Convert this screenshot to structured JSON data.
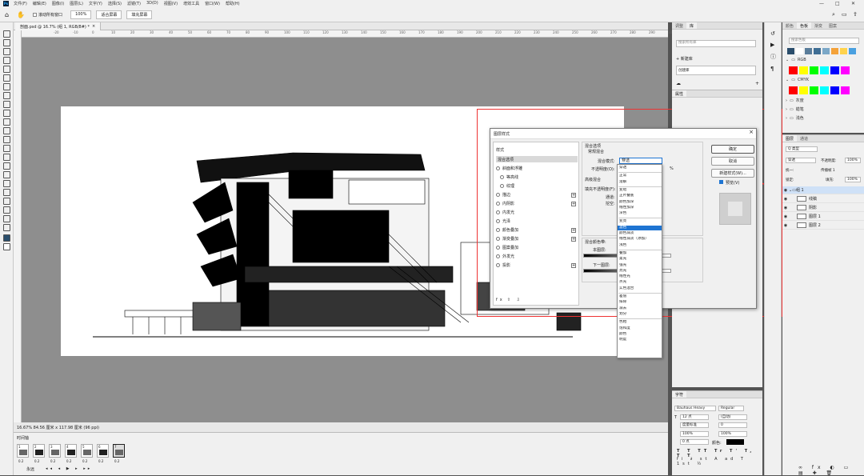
{
  "menu": {
    "logo": "Ps",
    "items": [
      "文件(F)",
      "编辑(E)",
      "图像(I)",
      "图层(L)",
      "文字(Y)",
      "选择(S)",
      "滤镜(T)",
      "3D(D)",
      "视图(V)",
      "增效工具",
      "窗口(W)",
      "帮助(H)"
    ]
  },
  "options_bar": {
    "scroll_all": "滚动所有窗口",
    "zoom": "100%",
    "fit_screen": "适合屏幕",
    "fill_screen": "填充屏幕"
  },
  "document": {
    "tab_title": "剖面.psd @ 16.7% (组 1, RGB/8#) *",
    "status": "16.67%  84.56 厘米 x 117.98 厘米 (96 ppi)"
  },
  "ruler_ticks": [
    "-20",
    "-10",
    "0",
    "10",
    "20",
    "30",
    "40",
    "50",
    "60",
    "70",
    "80",
    "90",
    "100",
    "110",
    "120",
    "130",
    "140",
    "150",
    "160",
    "170",
    "180",
    "190",
    "200",
    "210",
    "220",
    "230",
    "240",
    "250",
    "260",
    "270",
    "280",
    "290",
    "300",
    "310"
  ],
  "timeline": {
    "title": "时间轴",
    "frames": [
      {
        "n": "1",
        "delay": "0.2"
      },
      {
        "n": "2",
        "delay": "0.2"
      },
      {
        "n": "3",
        "delay": "0.2"
      },
      {
        "n": "4",
        "delay": "0.2"
      },
      {
        "n": "5",
        "delay": "0.2"
      },
      {
        "n": "6",
        "delay": "0.2"
      },
      {
        "n": "7",
        "delay": "0.2"
      }
    ],
    "loop": "永远"
  },
  "panel_a": {
    "tabs": [
      "调整",
      "库"
    ],
    "search_placeholder": "搜索所有库",
    "new_library": "新建库",
    "library_item": "创建库"
  },
  "panel_b": {
    "tabs": [
      "属性"
    ]
  },
  "char_panel": {
    "tab": "字符",
    "font": "Bauhaus Heavy",
    "style": "Regular",
    "size": "12 点",
    "leading": "(自动)",
    "kerning": "度量标准",
    "tracking": "0",
    "scale_v": "100%",
    "scale_h": "100%",
    "baseline": "0 点",
    "color_label": "颜色:"
  },
  "swatches_panel": {
    "tabs": [
      "颜色",
      "色板",
      "渐变",
      "图案"
    ],
    "search_placeholder": "搜索色板",
    "recent_colors": [
      "#2a4d6b",
      "#ffffff",
      "#5a7d9a",
      "#3f6e94",
      "#7aa7c7",
      "#f4a23a",
      "#ffd34d",
      "#4aa0e0"
    ],
    "groups": [
      {
        "name": "RGB",
        "colors": [
          "#ff0000",
          "#ffff00",
          "#00ff00",
          "#00ffff",
          "#0000ff",
          "#ff00ff"
        ]
      },
      {
        "name": "CMYK",
        "colors": [
          "#ff0000",
          "#ffff00",
          "#00ff00",
          "#00ffff",
          "#0000ff",
          "#ff00ff"
        ]
      },
      {
        "name": "灰度"
      },
      {
        "name": "蜡笔"
      },
      {
        "name": "浅色"
      }
    ]
  },
  "layers_panel": {
    "tabs": [
      "图层",
      "通道"
    ],
    "kind": "Q 类型",
    "blend_mode": "穿透",
    "opacity_label": "不透明度:",
    "opacity": "100%",
    "lock_label": "锁定:",
    "fill_label": "填充:",
    "fill": "100%",
    "unify_label": "统一:",
    "propagate": "传播帧 1",
    "layers": [
      {
        "name": "组 1",
        "type": "group",
        "selected": true
      },
      {
        "name": "线稿",
        "type": "layer"
      },
      {
        "name": "阴影",
        "type": "layer"
      },
      {
        "name": "图层 1",
        "type": "layer"
      },
      {
        "name": "图层 2",
        "type": "layer"
      }
    ]
  },
  "layer_style_dialog": {
    "title": "图层样式",
    "styles_header": "样式",
    "blend_options": "混合选项",
    "styles": [
      {
        "label": "斜面和浮雕",
        "plus": false,
        "indent": false
      },
      {
        "label": "等高线",
        "plus": false,
        "indent": true
      },
      {
        "label": "纹理",
        "plus": false,
        "indent": true
      },
      {
        "label": "描边",
        "plus": true,
        "indent": false
      },
      {
        "label": "内阴影",
        "plus": true,
        "indent": false
      },
      {
        "label": "内发光",
        "plus": false,
        "indent": false
      },
      {
        "label": "光泽",
        "plus": false,
        "indent": false
      },
      {
        "label": "颜色叠加",
        "plus": true,
        "indent": false
      },
      {
        "label": "渐变叠加",
        "plus": true,
        "indent": false
      },
      {
        "label": "图案叠加",
        "plus": false,
        "indent": false
      },
      {
        "label": "外发光",
        "plus": false,
        "indent": false
      },
      {
        "label": "投影",
        "plus": true,
        "indent": false
      }
    ],
    "fx_label": "fx",
    "section_blend": "混合选项",
    "general_blend": "常规混合",
    "blend_mode_label": "混合模式:",
    "blend_mode_value": "穿透",
    "opacity_label": "不透明度(O):",
    "opacity_value": "%",
    "advanced": "高级混合",
    "fill_opacity_label": "填充不透明度(F):",
    "channels_label": "通道:",
    "knockout_label": "挖空:",
    "blend_if_label": "混合颜色带:",
    "this_layer": "本图层:",
    "underlying": "下一图层:",
    "ok": "确定",
    "cancel": "取消",
    "new_style": "新建样式(W)...",
    "preview": "预览(V)"
  },
  "blend_dropdown": {
    "items": [
      {
        "label": "穿透",
        "sep_before": false
      },
      {
        "label": "正常",
        "sep_before": true
      },
      {
        "label": "溶解",
        "sep_before": false
      },
      {
        "label": "变暗",
        "sep_before": true
      },
      {
        "label": "正片叠底",
        "sep_before": false
      },
      {
        "label": "颜色加深",
        "sep_before": false
      },
      {
        "label": "线性加深",
        "sep_before": false
      },
      {
        "label": "深色",
        "sep_before": false
      },
      {
        "label": "变亮",
        "sep_before": true
      },
      {
        "label": "滤色",
        "sep_before": false
      },
      {
        "label": "颜色减淡",
        "sep_before": false
      },
      {
        "label": "线性减淡（添加）",
        "sep_before": false
      },
      {
        "label": "浅色",
        "sep_before": false
      },
      {
        "label": "叠加",
        "sep_before": true
      },
      {
        "label": "柔光",
        "sep_before": false
      },
      {
        "label": "强光",
        "sep_before": false
      },
      {
        "label": "亮光",
        "sep_before": false
      },
      {
        "label": "线性光",
        "sep_before": false
      },
      {
        "label": "点光",
        "sep_before": false
      },
      {
        "label": "实色混合",
        "sep_before": false
      },
      {
        "label": "差值",
        "sep_before": true
      },
      {
        "label": "排除",
        "sep_before": false
      },
      {
        "label": "减去",
        "sep_before": false
      },
      {
        "label": "划分",
        "sep_before": false
      },
      {
        "label": "色相",
        "sep_before": true
      },
      {
        "label": "饱和度",
        "sep_before": false
      },
      {
        "label": "颜色",
        "sep_before": false
      },
      {
        "label": "明度",
        "sep_before": false
      }
    ],
    "selected": "滤色"
  },
  "colors": {
    "accent": "#1e74d2",
    "annotation": "#e33333"
  }
}
